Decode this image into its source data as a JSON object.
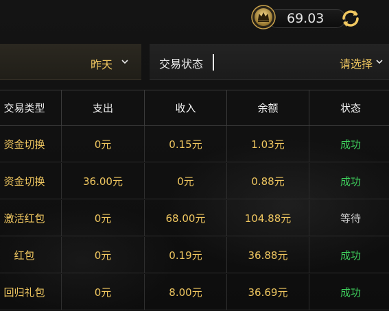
{
  "header": {
    "balance": "69.03",
    "crown_icon": "crown-coin-icon",
    "refresh_icon": "refresh-icon"
  },
  "filters": {
    "date_value": "昨天",
    "status_label": "交易状态",
    "status_placeholder": "请选择"
  },
  "table": {
    "columns": [
      "交易类型",
      "支出",
      "收入",
      "余额",
      "状态"
    ],
    "rows": [
      {
        "type": "资金切换",
        "expense": "0元",
        "income": "0.15元",
        "balance": "1.03元",
        "status": "成功"
      },
      {
        "type": "资金切换",
        "expense": "36.00元",
        "income": "0元",
        "balance": "0.88元",
        "status": "成功"
      },
      {
        "type": "激活红包",
        "expense": "0元",
        "income": "68.00元",
        "balance": "104.88元",
        "status": "等待"
      },
      {
        "type": "红包",
        "expense": "0元",
        "income": "0.19元",
        "balance": "36.88元",
        "status": "成功"
      },
      {
        "type": "回归礼包",
        "expense": "0元",
        "income": "8.00元",
        "balance": "36.69元",
        "status": "成功"
      }
    ]
  },
  "colors": {
    "gold": "#f0c760",
    "success": "#3ecf5c",
    "pending": "#cccccc"
  }
}
